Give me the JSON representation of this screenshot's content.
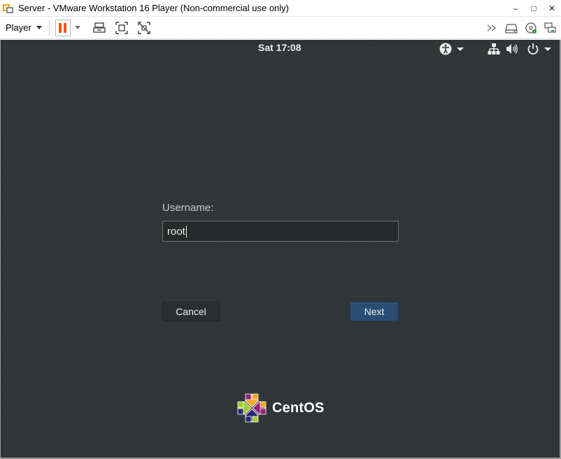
{
  "window": {
    "title": "Server - VMware Workstation 16 Player (Non-commercial use only)",
    "controls": {
      "minimize": "–",
      "maximize": "□",
      "close": "✕"
    }
  },
  "toolbar": {
    "player_label": "Player",
    "icons": [
      "pause-icon",
      "send-ctrl-alt-del-icon",
      "full-screen-icon",
      "unity-icon"
    ],
    "right_icons": [
      "more-icon",
      "hard-disk-icon",
      "cd-dvd-icon",
      "network-icon"
    ]
  },
  "vm": {
    "topbar": {
      "clock": "Sat 17:08",
      "icons": [
        "accessibility-icon",
        "network-icon",
        "volume-icon",
        "power-icon"
      ]
    },
    "login": {
      "username_label": "Username:",
      "username_value": "root",
      "cancel_label": "Cancel",
      "next_label": "Next"
    },
    "brand": {
      "name": "CentOS"
    },
    "colors": {
      "background": "#2e3436",
      "next_button": "#2a4d73"
    }
  }
}
